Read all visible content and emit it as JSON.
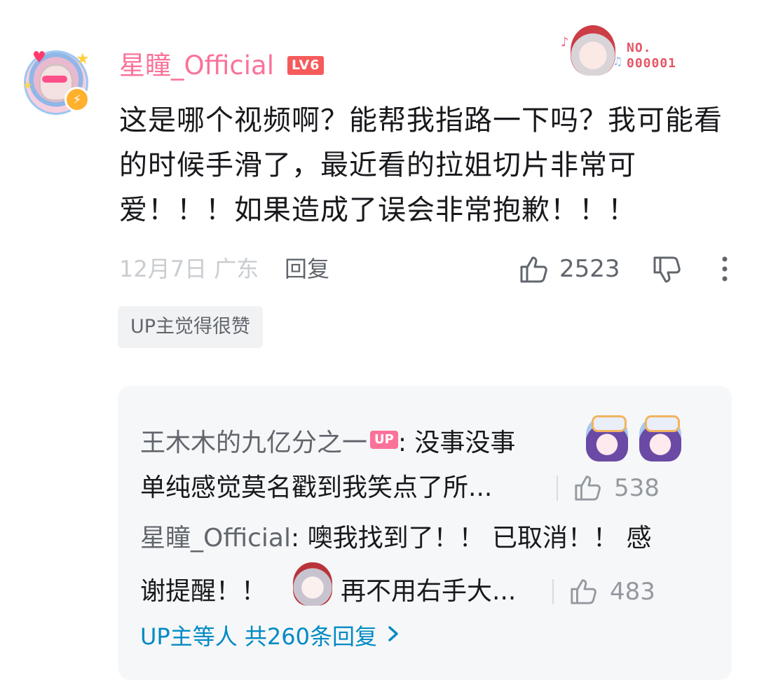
{
  "comment": {
    "username": "星瞳_Official",
    "level": "LV6",
    "badge": {
      "line1": "NO.",
      "line2": "000001"
    },
    "text": "这是哪个视频啊？能帮我指路一下吗？我可能看的时候手滑了，最近看的拉姐切片非常可爱！！！如果造成了误会非常抱歉！！！",
    "date": "12月7日 广东",
    "reply_label": "回复",
    "like_count": "2523",
    "tag": "UP主觉得很赞"
  },
  "replies": [
    {
      "name": "王木木的九亿分之一",
      "up_badge": "UP",
      "line1": "没事没事",
      "line2": "单纯感觉莫名戳到我笑点了所...",
      "like_count": "538"
    },
    {
      "name": "星瞳_Official",
      "line1": "噢我找到了！！ 已取消！！ 感",
      "line2a": "谢提醒！！",
      "line2b": "再不用右手大...",
      "like_count": "483"
    }
  ],
  "more_replies": "UP主等人 共260条回复",
  "colors": {
    "username": "#fb7299",
    "level": "#f55b5b",
    "link": "#008ac5",
    "panel_bg": "#f6f7f8"
  },
  "icons": [
    "thumb-up-icon",
    "thumb-down-icon",
    "more-vertical-icon",
    "chevron-right-icon",
    "verified-lightning-icon"
  ]
}
